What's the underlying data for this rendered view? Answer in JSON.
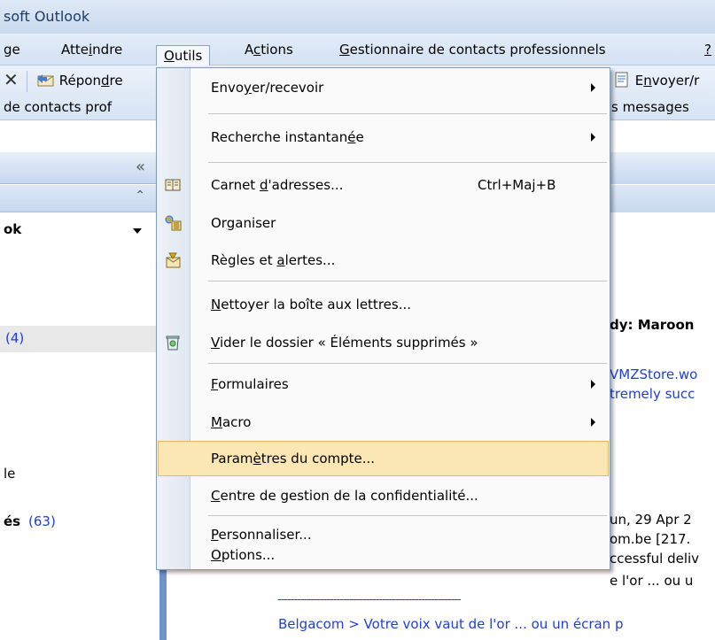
{
  "window": {
    "title": "soft Outlook"
  },
  "menubar": [
    {
      "label": "ge"
    },
    {
      "label": "Atteindre",
      "mnemonic": "i"
    },
    {
      "label": "Outils",
      "mnemonic": "O"
    },
    {
      "label": "Actions",
      "mnemonic": "c"
    },
    {
      "label": "Gestionnaire de contacts professionnels",
      "mnemonic": "G"
    },
    {
      "label": "?"
    }
  ],
  "toolbar": {
    "delete_label": "✕",
    "reply_label": "Répondre",
    "send_receive_label": "Envoyer/r",
    "bcm_label": "de contacts prof",
    "messages_label": "s messages"
  },
  "navpane": {
    "collapse_label": "«",
    "expand_label": "⌃",
    "mailbox_label": "ok",
    "folders": [
      {
        "name": "",
        "count": "(4)"
      },
      {
        "name": "le",
        "count": ""
      },
      {
        "name": "és",
        "count": "(63)"
      }
    ]
  },
  "reading": {
    "subject_fragment": "dy: Maroon",
    "link1": "VMZStore.wo",
    "link2": "tremely succ",
    "date_fragment": "un, 29 Apr 2",
    "from_fragment": "om.be [217.",
    "delivery_fragment": "ccessful deliv",
    "voice_fragment": "e l'or ... ou u",
    "dashes": "--------------------------------------------------------",
    "footer_link": "Belgacom > Votre voix vaut de l'or ... ou un écran p"
  },
  "dropdown": {
    "items": [
      {
        "label": "Envoyer/recevoir",
        "pre": "Envo",
        "u": "y",
        "post": "er/recevoir",
        "submenu": true,
        "shortcut": ""
      },
      {
        "label": "Recherche instantanée",
        "pre": "Recherche instantan",
        "u": "é",
        "post": "e",
        "submenu": true,
        "shortcut": ""
      },
      {
        "label": "Carnet d'adresses...",
        "pre": "Carnet ",
        "u": "d",
        "post": "'adresses...",
        "submenu": false,
        "shortcut": "Ctrl+Maj+B",
        "icon": "address-book-icon"
      },
      {
        "label": "Organiser",
        "pre": "Or",
        "u": "g",
        "post": "aniser",
        "submenu": false,
        "shortcut": "",
        "icon": "organize-icon"
      },
      {
        "label": "Règles et alertes...",
        "pre": "Règles et ",
        "u": "a",
        "post": "lertes...",
        "submenu": false,
        "shortcut": "",
        "icon": "rules-alerts-icon"
      },
      {
        "label": "Nettoyer la boîte aux lettres...",
        "pre": "",
        "u": "N",
        "post": "ettoyer la boîte aux lettres...",
        "submenu": false,
        "shortcut": ""
      },
      {
        "label": "Vider le dossier « Éléments supprimés »",
        "pre": "",
        "u": "V",
        "post": "ider le dossier « Éléments supprimés »",
        "submenu": false,
        "shortcut": "",
        "icon": "trash-icon"
      },
      {
        "label": "Formulaires",
        "pre": "",
        "u": "F",
        "post": "ormulaires",
        "submenu": true,
        "shortcut": ""
      },
      {
        "label": "Macro",
        "pre": "",
        "u": "M",
        "post": "acro",
        "submenu": true,
        "shortcut": ""
      },
      {
        "label": "Paramètres du compte...",
        "pre": "Param",
        "u": "è",
        "post": "tres du compte...",
        "submenu": false,
        "shortcut": "",
        "highlighted": true
      },
      {
        "label": "Centre de gestion de la confidentialité...",
        "pre": "",
        "u": "C",
        "post": "entre de gestion de la confidentialité...",
        "submenu": false,
        "shortcut": ""
      },
      {
        "label": "Personnaliser...",
        "pre": "",
        "u": "P",
        "post": "ersonnaliser...",
        "submenu": false,
        "shortcut": ""
      },
      {
        "label": "Options...",
        "pre": "",
        "u": "O",
        "post": "ptions...",
        "submenu": false,
        "shortcut": ""
      }
    ]
  },
  "colors": {
    "highlight": "#fbe7b3",
    "link": "#1f3fd8",
    "navsplit": "#6d93c9"
  }
}
